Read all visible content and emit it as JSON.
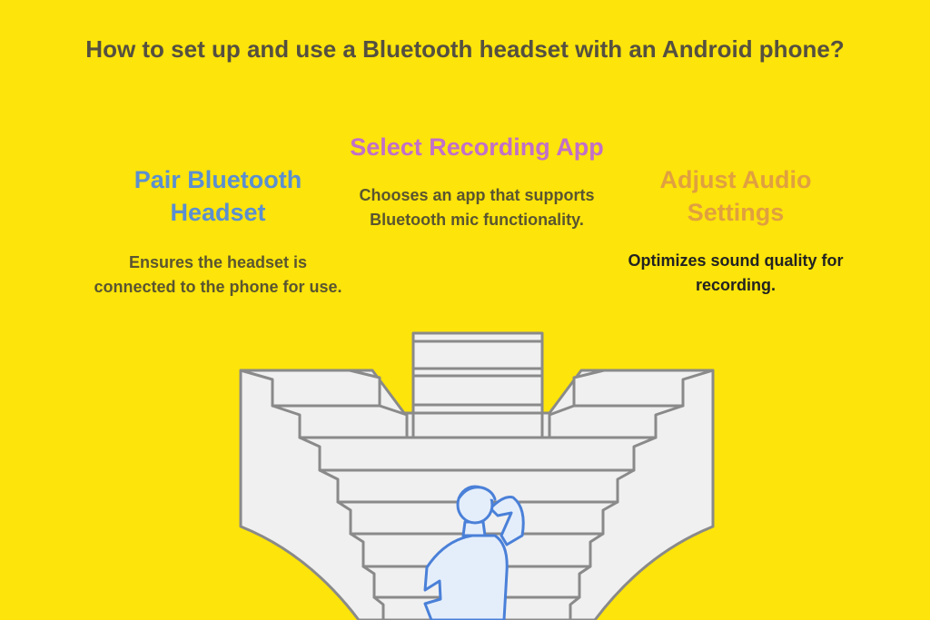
{
  "title": "How to set up and use a Bluetooth headset with an Android phone?",
  "steps": [
    {
      "heading": "Pair Bluetooth Headset",
      "description": "Ensures the headset is connected to the phone for use.",
      "color": "#5b8fd0"
    },
    {
      "heading": "Select Recording App",
      "description": "Chooses an app that supports Bluetooth mic functionality.",
      "color": "#c270c8"
    },
    {
      "heading": "Adjust Audio Settings",
      "description": "Optimizes sound quality for recording.",
      "color": "#e0a040"
    }
  ],
  "colors": {
    "background": "#fde40a",
    "stairs_fill": "#f0f0f0",
    "stairs_stroke": "#8a8a8a",
    "person_stroke": "#4a80d8",
    "person_fill": "#e4eefb"
  }
}
